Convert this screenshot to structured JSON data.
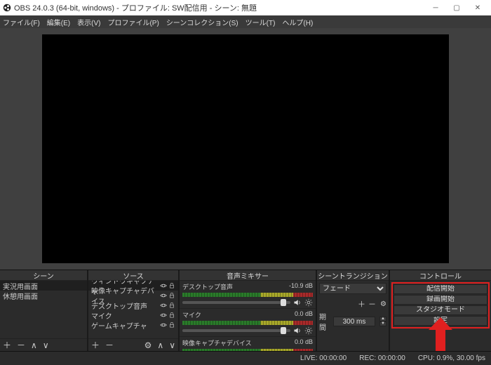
{
  "window": {
    "title": "OBS 24.0.3 (64-bit, windows) - プロファイル: SW配信用 - シーン: 無題"
  },
  "menu": {
    "file": "ファイル(F)",
    "edit": "編集(E)",
    "view": "表示(V)",
    "profile": "プロファイル(P)",
    "scene_collection": "シーンコレクション(S)",
    "tools": "ツール(T)",
    "help": "ヘルプ(H)"
  },
  "panels": {
    "scenes": {
      "title": "シーン",
      "items": [
        "実況用画面",
        "休憩用画面"
      ]
    },
    "sources": {
      "title": "ソース",
      "items": [
        "ウィンドウキャプチャ",
        "映像キャプチャデバイス",
        "デスクトップ音声",
        "マイク",
        "ゲームキャプチャ"
      ]
    },
    "mixer": {
      "title": "音声ミキサー",
      "channels": [
        {
          "name": "デスクトップ音声",
          "db": "-10.9 dB"
        },
        {
          "name": "マイク",
          "db": "0.0 dB"
        },
        {
          "name": "映像キャプチャデバイス",
          "db": "0.0 dB"
        }
      ]
    },
    "transitions": {
      "title": "シーントランジション",
      "selected": "フェード",
      "duration_label": "期間",
      "duration_value": "300 ms"
    },
    "controls": {
      "title": "コントロール",
      "buttons": [
        "配信開始",
        "録画開始",
        "スタジオモード",
        "設定"
      ]
    }
  },
  "statusbar": {
    "live": "LIVE: 00:00:00",
    "rec": "REC: 00:00:00",
    "cpu": "CPU: 0.9%, 30.00 fps"
  },
  "glyphs": {
    "plus": "＋",
    "minus": "－",
    "up": "∧",
    "down": "∨",
    "gear": "⚙",
    "dash": "—"
  }
}
